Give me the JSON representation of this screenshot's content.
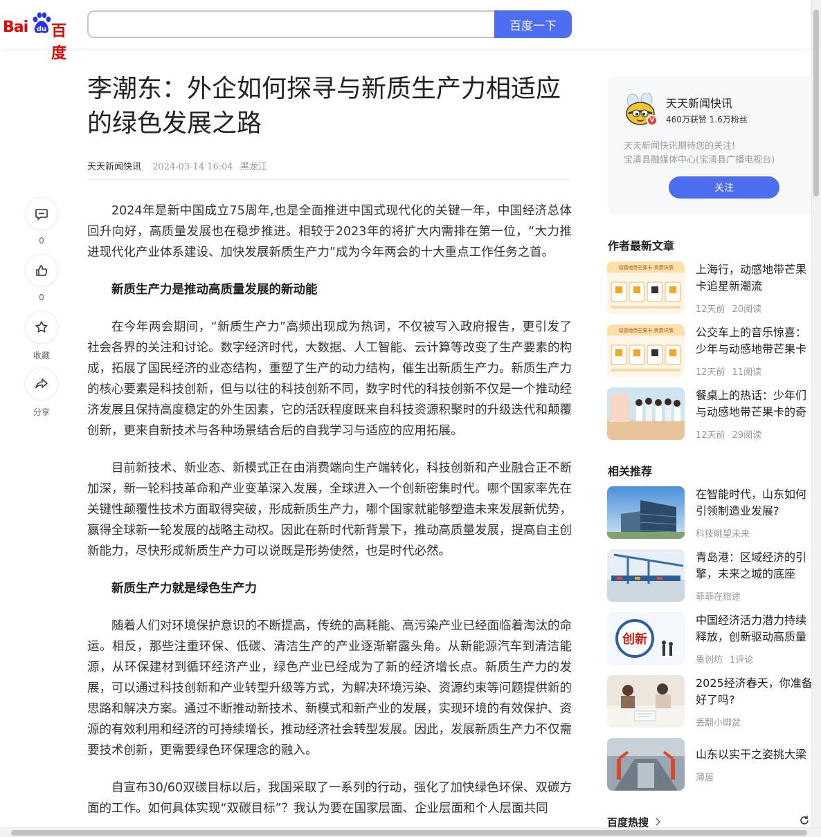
{
  "header": {
    "logo_text_left": "Bai",
    "logo_text_right": "百度",
    "search_value": "",
    "search_button": "百度一下"
  },
  "article": {
    "title": "李潮东：外企如何探寻与新质生产力相适应的绿色发展之路",
    "author": "天天新闻快讯",
    "date": "2024-03-14 16:04",
    "location": "黑龙江",
    "blocks": [
      {
        "type": "p",
        "text": "2024年是新中国成立75周年,也是全面推进中国式现代化的关键一年，中国经济总体回升向好，高质量发展也在稳步推进。相较于2023年的将扩大内需排在第一位，“大力推进现代化产业体系建设、加快发展新质生产力”成为今年两会的十大重点工作任务之首。"
      },
      {
        "type": "h",
        "text": "新质生产力是推动高质量发展的新动能"
      },
      {
        "type": "p",
        "text": "在今年两会期间，“新质生产力”高频出现成为热词，不仅被写入政府报告，更引发了社会各界的关注和讨论。数字经济时代，大数据、人工智能、云计算等改变了生产要素的构成，拓展了国民经济的业态结构，重塑了生产的动力结构，催生出新质生产力。新质生产力的核心要素是科技创新，但与以往的科技创新不同，数字时代的科技创新不仅是一个推动经济发展且保持高度稳定的外生因素，它的活跃程度既来自科技资源积聚时的升级迭代和颠覆创新，更来自新技术与各种场景结合后的自我学习与适应的应用拓展。"
      },
      {
        "type": "p",
        "text": "目前新技术、新业态、新模式正在由消费端向生产端转化，科技创新和产业融合正不断加深，新一轮科技革命和产业变革深入发展，全球进入一个创新密集时代。哪个国家率先在关键性颠覆性技术方面取得突破，形成新质生产力，哪个国家就能够塑造未来发展新优势，赢得全球新一轮发展的战略主动权。因此在新时代新背景下，推动高质量发展，提高自主创新能力，尽快形成新质生产力可以说既是形势使然，也是时代必然。"
      },
      {
        "type": "h",
        "text": "新质生产力就是绿色生产力"
      },
      {
        "type": "p",
        "text": "随着人们对环境保护意识的不断提高，传统的高耗能、高污染产业已经面临着淘汰的命运。相反，那些注重环保、低碳、清洁生产的产业逐渐崭露头角。从新能源汽车到清洁能源，从环保建材到循环经济产业，绿色产业已经成为了新的经济增长点。新质生产力的发展，可以通过科技创新和产业转型升级等方式，为解决环境污染、资源约束等问题提供新的思路和解决方案。通过不断推动新技术、新模式和新产业的发展，实现环境的有效保护、资源的有效利用和经济的可持续增长，推动经济社会转型发展。因此，发展新质生产力不仅需要技术创新，更需要绿色环保理念的融入。"
      },
      {
        "type": "p",
        "text": "自宣布30/60双碳目标以后，我国采取了一系列的行动，强化了加快绿色环保、双碳方面的工作。如何具体实现“双碳目标”？我认为要在国家层面、企业层面和个人层面共同"
      }
    ]
  },
  "actions": {
    "comment_count": "0",
    "like_count": "0",
    "collect_label": "收藏",
    "share_label": "分享"
  },
  "author_card": {
    "name": "天天新闻快讯",
    "stats": "460万获赞 1.6万粉丝",
    "desc1": "天天新闻快讯期待您的关注!",
    "desc2": "宝清县融媒体中心(宝清县广播电视台)",
    "follow_label": "关注",
    "badge": "V"
  },
  "latest": {
    "title": "作者最新文章",
    "items": [
      {
        "title": "上海行，动感地带芒果卡追星新潮流",
        "time": "12天前",
        "reads": "20阅读",
        "thumb_caption": "动感地带芒果卡·资费详情"
      },
      {
        "title": "公交车上的音乐惊喜：少年与动感地带芒果卡的共鸣",
        "time": "12天前",
        "reads": "11阅读",
        "thumb_caption": "动感地带芒果卡·资费详情"
      },
      {
        "title": "餐桌上的热话：少年们与动感地带芒果卡的奇妙邂逅",
        "time": "12天前",
        "reads": "29阅读",
        "thumb_caption": ""
      }
    ]
  },
  "related": {
    "title": "相关推荐",
    "items": [
      {
        "title": "在智能时代，山东如何引领制造业发展?",
        "source": "科技眺望未来",
        "extra": ""
      },
      {
        "title": "青岛港：区域经济的引擎，未来之城的底座",
        "source": "菲菲在旅途",
        "extra": ""
      },
      {
        "title": "中国经济活力潜力持续释放，创新驱动高质量发展",
        "source": "墨创坊",
        "extra": "1评论",
        "thumb_caption": "创新"
      },
      {
        "title": "2025经济春天，你准备好了吗?",
        "source": "丢翻小脚盆",
        "extra": ""
      },
      {
        "title": "山东以实干之姿挑大梁",
        "source": "薄居",
        "extra": ""
      }
    ]
  },
  "hot": {
    "title": "百度热搜"
  }
}
